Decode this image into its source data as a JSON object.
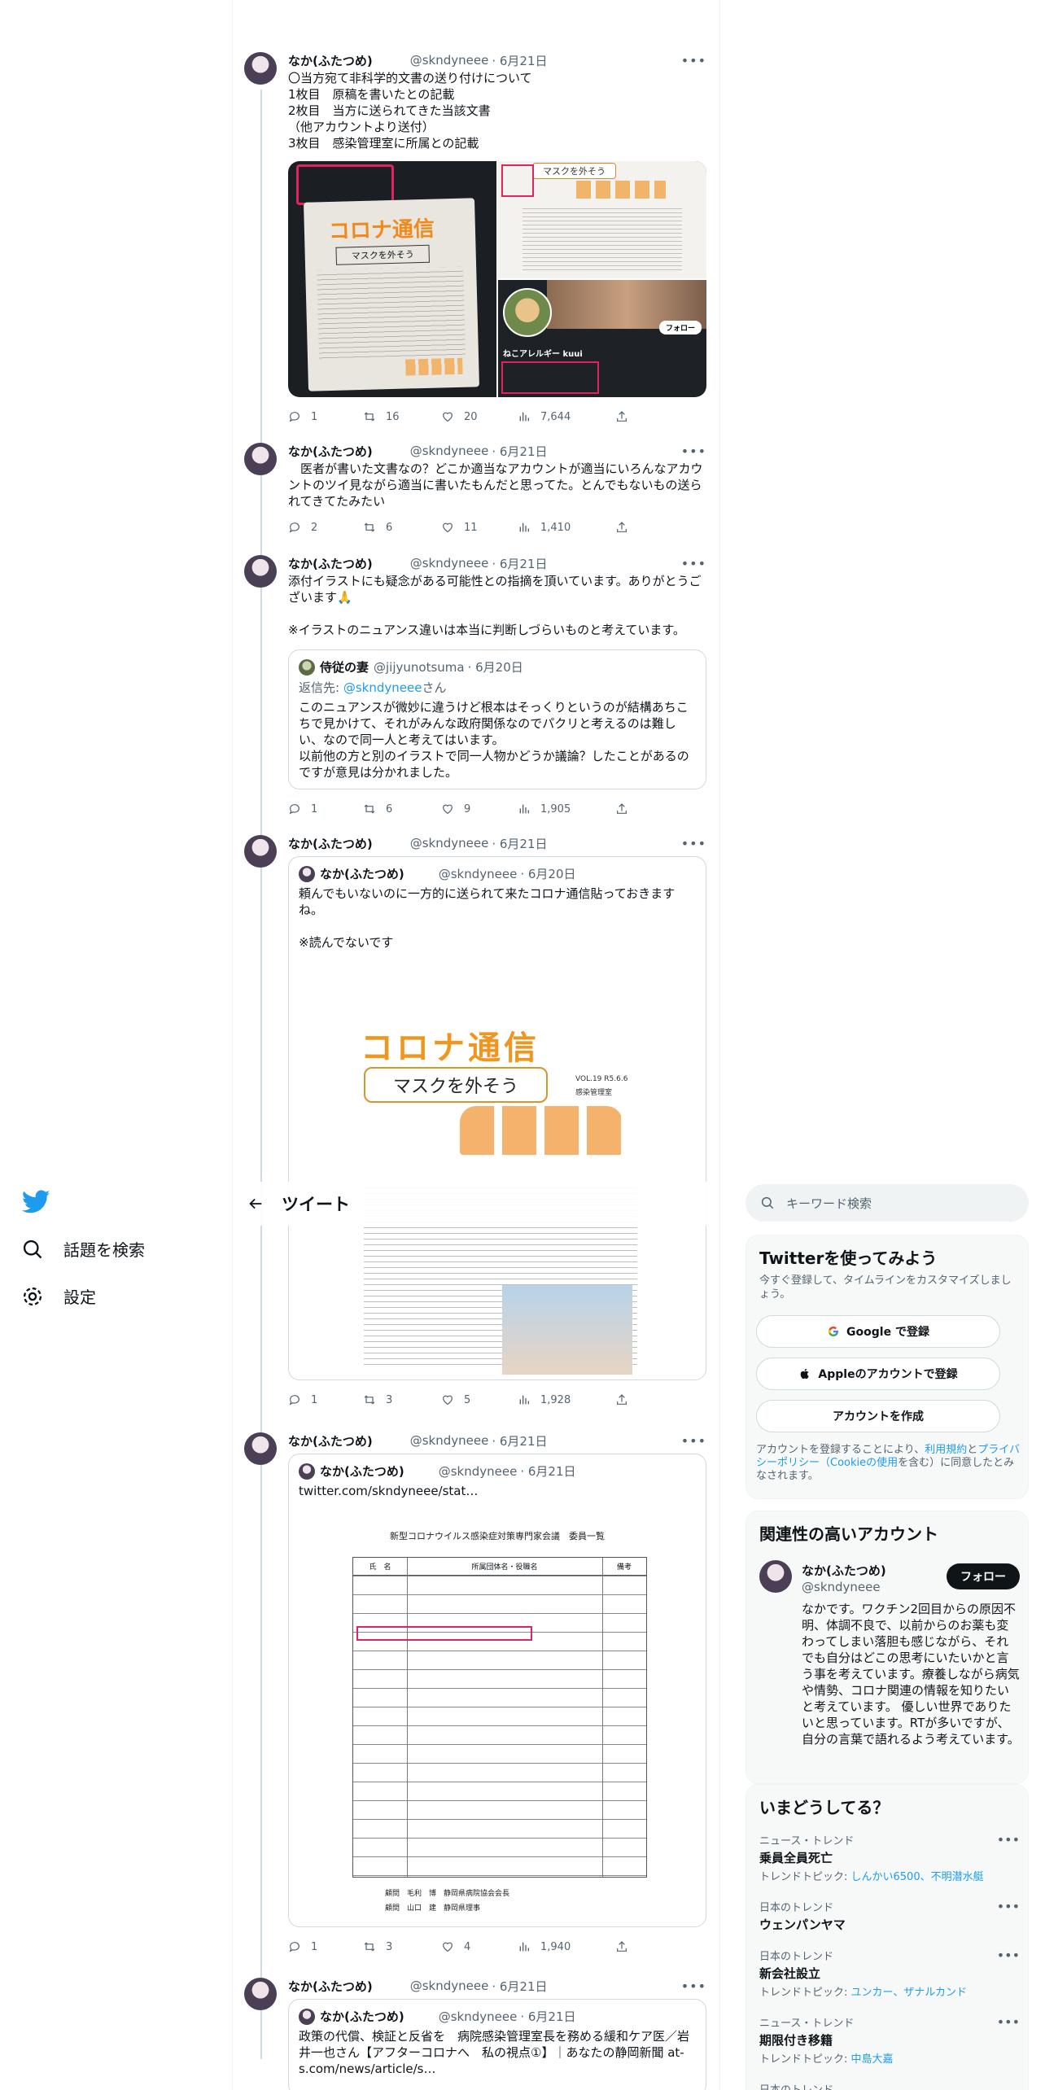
{
  "header": {
    "title": "ツイート"
  },
  "nav": {
    "explore": "話題を検索",
    "settings": "設定"
  },
  "search": {
    "placeholder": "キーワード検索"
  },
  "tweets": [
    {
      "name": "なか(ふたつめ)",
      "handle": "@skndyneee",
      "date": "· 6月21日",
      "text": "〇当方宛て非科学的文書の送り付けについて\n1枚目　原稿を書いたとの記載\n2枚目　当方に送られてきた当該文書\n（他アカウントより送付）\n3枚目　感染管理室に所属との記載",
      "media": {
        "left_logo": "コロナ通信",
        "left_caption": "マスクを外そう",
        "rt_caption": "マスクを外そう",
        "rb_user": "ねこアレルギー kuui",
        "rb_follow": "フォロー"
      },
      "stats": {
        "reply": "1",
        "retweet": "16",
        "like": "20",
        "views": "7,644"
      }
    },
    {
      "name": "なか(ふたつめ)",
      "handle": "@skndyneee",
      "date": "· 6月21日",
      "text": "　医者が書いた文書なの？どこか適当なアカウントが適当にいろんなアカウントのツイ見ながら適当に書いたもんだと思ってた。とんでもないもの送られてきてたみたい",
      "stats": {
        "reply": "2",
        "retweet": "6",
        "like": "11",
        "views": "1,410"
      }
    },
    {
      "name": "なか(ふたつめ)",
      "handle": "@skndyneee",
      "date": "· 6月21日",
      "text": "添付イラストにも疑念がある可能性との指摘を頂いています。ありがとうございます🙏\n\n※イラストのニュアンス違いは本当に判断しづらいものと考えています。",
      "quote": {
        "name": "侍従の妻",
        "handle": "@jijyunotsuma",
        "date": "· 6月20日",
        "reply_to": "返信先: ",
        "reply_link": "@skndyneee",
        "reply_suffix": "さん",
        "text": "このニュアンスが微妙に違うけど根本はそっくりというのが結構あちこちで見かけて、それがみんな政府関係なのでパクリと考えるのは難しい、なので同一人と考えてはいます。\n以前他の方と別のイラストで同一人物かどうか議論？したことがあるのですが意見は分かれました。"
      },
      "stats": {
        "reply": "1",
        "retweet": "6",
        "like": "9",
        "views": "1,905"
      }
    },
    {
      "name": "なか(ふたつめ)",
      "handle": "@skndyneee",
      "date": "· 6月21日",
      "quote": {
        "name": "なか(ふたつめ)",
        "handle": "@skndyneee",
        "date": "· 6月20日",
        "text": "頼んでもいないのに一方的に送られて来たコロナ通信貼っておきますね。\n\n※読んでないです",
        "img_logo": "コロナ通信",
        "img_caption": "マスクを外そう",
        "img_vol": "VOL.19 R5.6.6",
        "img_dept": "感染管理室"
      },
      "stats": {
        "reply": "1",
        "retweet": "3",
        "like": "5",
        "views": "1,928"
      }
    },
    {
      "name": "なか(ふたつめ)",
      "handle": "@skndyneee",
      "date": "· 6月21日",
      "quote": {
        "name": "なか(ふたつめ)",
        "handle": "@skndyneee",
        "date": "· 6月21日",
        "text": "twitter.com/skndyneee/stat…",
        "doc_title": "新型コロナウイルス感染症対策専門家会議　委員一覧",
        "doc_headers": [
          "氏　名",
          "所属団体名・役職名",
          "備考"
        ],
        "doc_footer_1": "顧問　毛利　博　静岡県病院協会会長",
        "doc_footer_2": "顧問　山口　建　静岡県理事"
      },
      "stats": {
        "reply": "1",
        "retweet": "3",
        "like": "4",
        "views": "1,940"
      }
    },
    {
      "name": "なか(ふたつめ)",
      "handle": "@skndyneee",
      "date": "· 6月21日",
      "quote": {
        "name": "なか(ふたつめ)",
        "handle": "@skndyneee",
        "date": "· 6月21日",
        "text": "政策の代償、検証と反省を　病院感染管理室長を務める緩和ケア医／岩井一也さん【アフターコロナへ　私の視点①】｜あなたの静岡新聞 at-s.com/news/article/s…"
      }
    }
  ],
  "signup": {
    "title": "Twitterを使ってみよう",
    "subtitle": "今すぐ登録して、タイムラインをカスタマイズしましょう。",
    "google": "Google で登録",
    "apple": "Appleのアカウントで登録",
    "create": "アカウントを作成",
    "legal_1": "アカウントを登録することにより、",
    "legal_terms": "利用規約",
    "legal_2": "と",
    "legal_privacy": "プライバシーポリシー（Cookieの使用",
    "legal_3": "を含む）に同意したとみなされます。"
  },
  "related": {
    "title": "関連性の高いアカウント",
    "name": "なか(ふたつめ)",
    "handle": "@skndyneee",
    "follow": "フォロー",
    "bio": "なかです。ワクチン2回目からの原因不明、体調不良で、以前からのお薬も変わってしまい落胆も感じながら、それでも自分はどこの思考にいたいかと言う事を考えています。療養しながら病気や情勢、コロナ関連の情報を知りたいと考えています。 優しい世界でありたいと思っています。RTが多いですが、自分の言葉で語れるよう考えています。"
  },
  "trends": {
    "title": "いまどうしてる？",
    "items": [
      {
        "category": "ニュース・トレンド",
        "name": "乗員全員死亡",
        "topics_prefix": "トレンドトピック: ",
        "topics": "しんかい6500、不明潜水艇"
      },
      {
        "category": "日本のトレンド",
        "name": "ウェンパンヤマ",
        "topics_prefix": "",
        "topics": ""
      },
      {
        "category": "日本のトレンド",
        "name": "新会社設立",
        "topics_prefix": "トレンドトピック: ",
        "topics": "ユンカー、ザナルカンド"
      },
      {
        "category": "ニュース・トレンド",
        "name": "期限付き移籍",
        "topics_prefix": "トレンドトピック: ",
        "topics": "中島大嘉"
      },
      {
        "category": "日本のトレンド",
        "name": "",
        "topics_prefix": "",
        "topics": ""
      }
    ]
  },
  "colors": {
    "accent": "#1d9bf0",
    "text": "#0f1419",
    "muted": "#536471",
    "border": "#cfd9de"
  },
  "icons": [
    "twitter-bird-icon",
    "hash-icon",
    "gear-icon",
    "back-arrow-icon",
    "search-icon",
    "reply-icon",
    "retweet-icon",
    "like-icon",
    "views-icon",
    "share-icon",
    "more-icon",
    "google-icon",
    "apple-icon"
  ]
}
